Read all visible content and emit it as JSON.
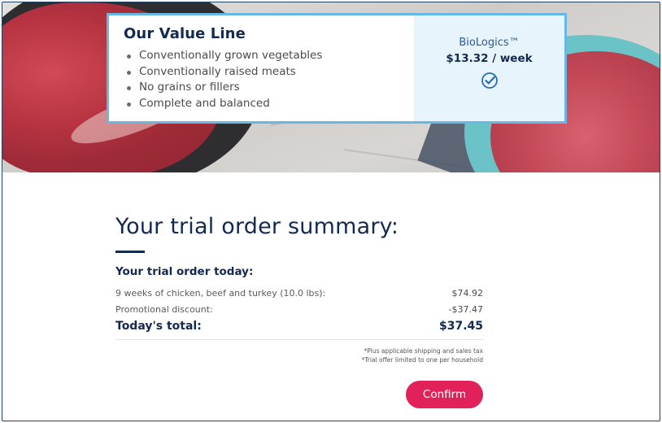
{
  "value_card": {
    "title": "Our Value Line",
    "features": [
      "Conventionally grown vegetables",
      "Conventionally raised meats",
      "No grains or fillers",
      "Complete and balanced"
    ],
    "brand": "BioLogics™",
    "price": "$13.32 / week",
    "check_icon": "check-circle-icon",
    "accent_color": "#66b7e3"
  },
  "summary": {
    "heading": "Your trial order summary:",
    "subheading": "Your trial order today:",
    "lines": [
      {
        "label": "9 weeks of chicken, beef and turkey (10.0 lbs):",
        "amount": "$74.92"
      },
      {
        "label": "Promotional discount:",
        "amount": "-$37.47"
      }
    ],
    "total_label": "Today's total:",
    "total_amount": "$37.45",
    "fine_print": [
      "*Plus applicable shipping and sales tax",
      "*Trial offer limited to one per household"
    ],
    "confirm_label": "Confirm",
    "confirm_color": "#e0215a",
    "text_color": "#14294f"
  }
}
